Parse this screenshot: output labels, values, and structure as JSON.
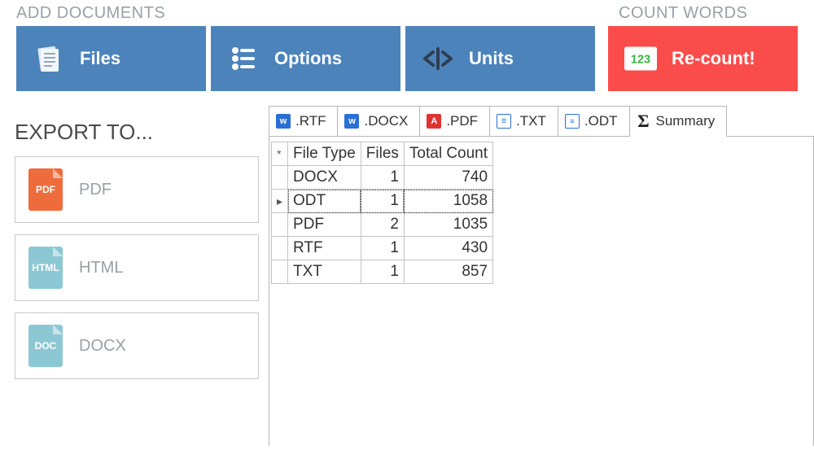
{
  "headers": {
    "add_documents": "ADD DOCUMENTS",
    "count_words": "COUNT WORDS"
  },
  "toolbar": {
    "files": "Files",
    "options": "Options",
    "units": "Units",
    "recount": "Re-count!"
  },
  "sidebar": {
    "title": "EXPORT TO...",
    "items": [
      {
        "badge": "PDF",
        "label": "PDF",
        "color": "pdf"
      },
      {
        "badge": "HTML",
        "label": "HTML",
        "color": "html"
      },
      {
        "badge": "DOC",
        "label": "DOCX",
        "color": "doc"
      }
    ]
  },
  "tabs": [
    {
      "label": ".RTF",
      "icon": "w"
    },
    {
      "label": ".DOCX",
      "icon": "w"
    },
    {
      "label": ".PDF",
      "icon": "pdfi"
    },
    {
      "label": ".TXT",
      "icon": "txti"
    },
    {
      "label": ".ODT",
      "icon": "odti"
    }
  ],
  "summary_tab_label": "Summary",
  "summary": {
    "columns": [
      "File Type",
      "Files",
      "Total Count"
    ],
    "corner_glyph": "*",
    "selected_row_index": 1,
    "rows": [
      {
        "type": "DOCX",
        "files": 1,
        "total": 740
      },
      {
        "type": "ODT",
        "files": 1,
        "total": 1058
      },
      {
        "type": "PDF",
        "files": 2,
        "total": 1035
      },
      {
        "type": "RTF",
        "files": 1,
        "total": 430
      },
      {
        "type": "TXT",
        "files": 1,
        "total": 857
      }
    ]
  },
  "chart_data": {
    "type": "table",
    "title": "Summary",
    "columns": [
      "File Type",
      "Files",
      "Total Count"
    ],
    "rows": [
      [
        "DOCX",
        1,
        740
      ],
      [
        "ODT",
        1,
        1058
      ],
      [
        "PDF",
        2,
        1035
      ],
      [
        "RTF",
        1,
        430
      ],
      [
        "TXT",
        1,
        857
      ]
    ]
  }
}
